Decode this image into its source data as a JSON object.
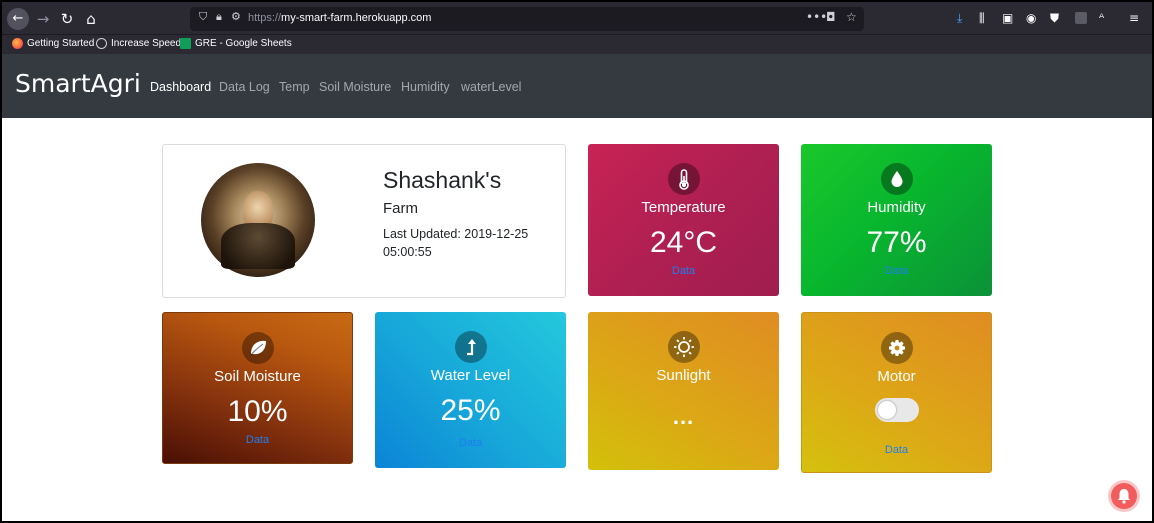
{
  "browser": {
    "url_protocol": "https://",
    "url_host": "my-smart-farm.herokuapp.com",
    "bookmarks": [
      {
        "label": "Getting Started",
        "icon": "firefox-icon"
      },
      {
        "label": "Increase Speed",
        "icon": "globe-icon"
      },
      {
        "label": "GRE - Google Sheets",
        "icon": "sheets-icon"
      }
    ]
  },
  "navbar": {
    "brand": "SmartAgri",
    "items": [
      {
        "label": "Dashboard",
        "active": true
      },
      {
        "label": "Data Log"
      },
      {
        "label": "Temp"
      },
      {
        "label": "Soil Moisture"
      },
      {
        "label": "Humidity"
      },
      {
        "label": "waterLevel"
      }
    ]
  },
  "profile": {
    "name": "Shashank's",
    "subtitle": "Farm",
    "last_updated": "Last Updated: 2019-12-25 05:00:55"
  },
  "sensors": {
    "temperature": {
      "title": "Temperature",
      "value": "24°C",
      "link": "Data",
      "icon": "thermometer-icon",
      "color": "#b01f52"
    },
    "humidity": {
      "title": "Humidity",
      "value": "77%",
      "link": "Data",
      "icon": "droplet-icon",
      "color": "#08b72e"
    },
    "soil": {
      "title": "Soil Moisture",
      "value": "10%",
      "link": "Data",
      "icon": "leaf-icon",
      "color": "#8a350e"
    },
    "water": {
      "title": "Water Level",
      "value": "25%",
      "link": "Data",
      "icon": "level-up-arrow-icon",
      "color": "#17a7d9"
    },
    "sunlight": {
      "title": "Sunlight",
      "value": "...",
      "icon": "sun-icon",
      "color": "#dca616"
    },
    "motor": {
      "title": "Motor",
      "link": "Data",
      "icon": "gear-icon",
      "state": "off",
      "color": "#dda617"
    }
  },
  "colors": {
    "navbar": "#343a40",
    "link": "#1e7ef0",
    "notification": "#f25c5c"
  }
}
